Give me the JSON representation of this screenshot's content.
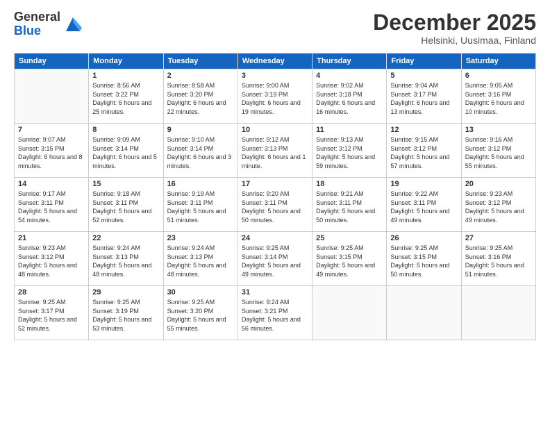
{
  "header": {
    "logo_general": "General",
    "logo_blue": "Blue",
    "month_title": "December 2025",
    "location": "Helsinki, Uusimaa, Finland"
  },
  "weekdays": [
    "Sunday",
    "Monday",
    "Tuesday",
    "Wednesday",
    "Thursday",
    "Friday",
    "Saturday"
  ],
  "weeks": [
    [
      {
        "day": "",
        "sunrise": "",
        "sunset": "",
        "daylight": ""
      },
      {
        "day": "1",
        "sunrise": "Sunrise: 8:56 AM",
        "sunset": "Sunset: 3:22 PM",
        "daylight": "Daylight: 6 hours and 25 minutes."
      },
      {
        "day": "2",
        "sunrise": "Sunrise: 8:58 AM",
        "sunset": "Sunset: 3:20 PM",
        "daylight": "Daylight: 6 hours and 22 minutes."
      },
      {
        "day": "3",
        "sunrise": "Sunrise: 9:00 AM",
        "sunset": "Sunset: 3:19 PM",
        "daylight": "Daylight: 6 hours and 19 minutes."
      },
      {
        "day": "4",
        "sunrise": "Sunrise: 9:02 AM",
        "sunset": "Sunset: 3:18 PM",
        "daylight": "Daylight: 6 hours and 16 minutes."
      },
      {
        "day": "5",
        "sunrise": "Sunrise: 9:04 AM",
        "sunset": "Sunset: 3:17 PM",
        "daylight": "Daylight: 6 hours and 13 minutes."
      },
      {
        "day": "6",
        "sunrise": "Sunrise: 9:05 AM",
        "sunset": "Sunset: 3:16 PM",
        "daylight": "Daylight: 6 hours and 10 minutes."
      }
    ],
    [
      {
        "day": "7",
        "sunrise": "Sunrise: 9:07 AM",
        "sunset": "Sunset: 3:15 PM",
        "daylight": "Daylight: 6 hours and 8 minutes."
      },
      {
        "day": "8",
        "sunrise": "Sunrise: 9:09 AM",
        "sunset": "Sunset: 3:14 PM",
        "daylight": "Daylight: 6 hours and 5 minutes."
      },
      {
        "day": "9",
        "sunrise": "Sunrise: 9:10 AM",
        "sunset": "Sunset: 3:14 PM",
        "daylight": "Daylight: 6 hours and 3 minutes."
      },
      {
        "day": "10",
        "sunrise": "Sunrise: 9:12 AM",
        "sunset": "Sunset: 3:13 PM",
        "daylight": "Daylight: 6 hours and 1 minute."
      },
      {
        "day": "11",
        "sunrise": "Sunrise: 9:13 AM",
        "sunset": "Sunset: 3:12 PM",
        "daylight": "Daylight: 5 hours and 59 minutes."
      },
      {
        "day": "12",
        "sunrise": "Sunrise: 9:15 AM",
        "sunset": "Sunset: 3:12 PM",
        "daylight": "Daylight: 5 hours and 57 minutes."
      },
      {
        "day": "13",
        "sunrise": "Sunrise: 9:16 AM",
        "sunset": "Sunset: 3:12 PM",
        "daylight": "Daylight: 5 hours and 55 minutes."
      }
    ],
    [
      {
        "day": "14",
        "sunrise": "Sunrise: 9:17 AM",
        "sunset": "Sunset: 3:11 PM",
        "daylight": "Daylight: 5 hours and 54 minutes."
      },
      {
        "day": "15",
        "sunrise": "Sunrise: 9:18 AM",
        "sunset": "Sunset: 3:11 PM",
        "daylight": "Daylight: 5 hours and 52 minutes."
      },
      {
        "day": "16",
        "sunrise": "Sunrise: 9:19 AM",
        "sunset": "Sunset: 3:11 PM",
        "daylight": "Daylight: 5 hours and 51 minutes."
      },
      {
        "day": "17",
        "sunrise": "Sunrise: 9:20 AM",
        "sunset": "Sunset: 3:11 PM",
        "daylight": "Daylight: 5 hours and 50 minutes."
      },
      {
        "day": "18",
        "sunrise": "Sunrise: 9:21 AM",
        "sunset": "Sunset: 3:11 PM",
        "daylight": "Daylight: 5 hours and 50 minutes."
      },
      {
        "day": "19",
        "sunrise": "Sunrise: 9:22 AM",
        "sunset": "Sunset: 3:11 PM",
        "daylight": "Daylight: 5 hours and 49 minutes."
      },
      {
        "day": "20",
        "sunrise": "Sunrise: 9:23 AM",
        "sunset": "Sunset: 3:12 PM",
        "daylight": "Daylight: 5 hours and 49 minutes."
      }
    ],
    [
      {
        "day": "21",
        "sunrise": "Sunrise: 9:23 AM",
        "sunset": "Sunset: 3:12 PM",
        "daylight": "Daylight: 5 hours and 48 minutes."
      },
      {
        "day": "22",
        "sunrise": "Sunrise: 9:24 AM",
        "sunset": "Sunset: 3:13 PM",
        "daylight": "Daylight: 5 hours and 48 minutes."
      },
      {
        "day": "23",
        "sunrise": "Sunrise: 9:24 AM",
        "sunset": "Sunset: 3:13 PM",
        "daylight": "Daylight: 5 hours and 48 minutes."
      },
      {
        "day": "24",
        "sunrise": "Sunrise: 9:25 AM",
        "sunset": "Sunset: 3:14 PM",
        "daylight": "Daylight: 5 hours and 49 minutes."
      },
      {
        "day": "25",
        "sunrise": "Sunrise: 9:25 AM",
        "sunset": "Sunset: 3:15 PM",
        "daylight": "Daylight: 5 hours and 49 minutes."
      },
      {
        "day": "26",
        "sunrise": "Sunrise: 9:25 AM",
        "sunset": "Sunset: 3:15 PM",
        "daylight": "Daylight: 5 hours and 50 minutes."
      },
      {
        "day": "27",
        "sunrise": "Sunrise: 9:25 AM",
        "sunset": "Sunset: 3:16 PM",
        "daylight": "Daylight: 5 hours and 51 minutes."
      }
    ],
    [
      {
        "day": "28",
        "sunrise": "Sunrise: 9:25 AM",
        "sunset": "Sunset: 3:17 PM",
        "daylight": "Daylight: 5 hours and 52 minutes."
      },
      {
        "day": "29",
        "sunrise": "Sunrise: 9:25 AM",
        "sunset": "Sunset: 3:19 PM",
        "daylight": "Daylight: 5 hours and 53 minutes."
      },
      {
        "day": "30",
        "sunrise": "Sunrise: 9:25 AM",
        "sunset": "Sunset: 3:20 PM",
        "daylight": "Daylight: 5 hours and 55 minutes."
      },
      {
        "day": "31",
        "sunrise": "Sunrise: 9:24 AM",
        "sunset": "Sunset: 3:21 PM",
        "daylight": "Daylight: 5 hours and 56 minutes."
      },
      {
        "day": "",
        "sunrise": "",
        "sunset": "",
        "daylight": ""
      },
      {
        "day": "",
        "sunrise": "",
        "sunset": "",
        "daylight": ""
      },
      {
        "day": "",
        "sunrise": "",
        "sunset": "",
        "daylight": ""
      }
    ]
  ]
}
